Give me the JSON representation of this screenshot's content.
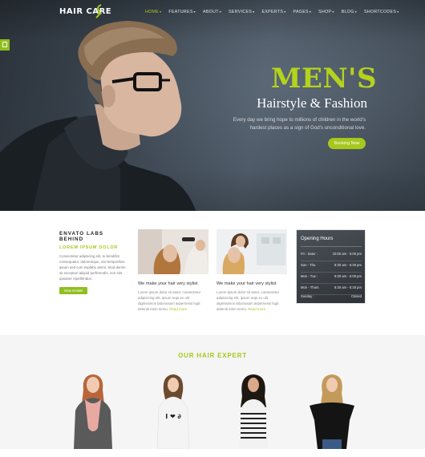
{
  "brand": {
    "name": "HAIR CARE",
    "accent": "#a6c81d"
  },
  "nav": {
    "items": [
      {
        "label": "HOME",
        "active": true
      },
      {
        "label": "FEATURES",
        "active": false
      },
      {
        "label": "ABOUT",
        "active": false
      },
      {
        "label": "SERVICES",
        "active": false
      },
      {
        "label": "EXPERTS",
        "active": false
      },
      {
        "label": "PAGES",
        "active": false
      },
      {
        "label": "SHOP",
        "active": false
      },
      {
        "label": "BLOG",
        "active": false
      },
      {
        "label": "SHORTCODES",
        "active": false
      }
    ]
  },
  "hero": {
    "title": "MEN'S",
    "subtitle": "Hairstyle & Fashion",
    "text": "Every day we bring hope to millions of children in the world's hardest places as a sign of God's unconditional love.",
    "button": "Booking Now"
  },
  "intro": {
    "heading": "ENVATO LABS BEHIND",
    "subheading": "LOREM IPSUM DOLOR",
    "body": "Consectetur adipiscing elit, to bendifim consequatur, doloremque, nisi temporibus ipsum sed cum explabo animi. Stud denim sit excepturi aliquid perferendis, non sint qusaner repellendus.",
    "button": "View Details"
  },
  "cards": [
    {
      "title": "We make your hair very stylist",
      "body": "Lorem ipsum dolor sit amet, consectetur adipisicing elit, ipsum reqs ex ulit dignissimos laboriosam aspernessi fugit deleniti enim nemo.",
      "more": "Read more"
    },
    {
      "title": "We make your hair very stylist",
      "body": "Lorem ipsum dolor sit amet, consectetur adipisicing elit, ipsum reqs ex ulit dignissimos laboriosam aspernessi fugit deleniti enim nemo.",
      "more": "Read more"
    }
  ],
  "hours": {
    "heading": "Opening Hours",
    "rows": [
      {
        "day": "Fri - Satur :",
        "time": "10:00 am - 6:00 pm"
      },
      {
        "day": "Sun - Thu",
        "time": "8:30 am - 5:30 pm"
      },
      {
        "day": "Mon - Tue :",
        "time": "9:30 am - 5:00 pm"
      },
      {
        "day": "Mon - Thurs",
        "time": "8:30 am - 5:30 pm"
      },
      {
        "day": "Sunday :",
        "time": "Closed"
      }
    ]
  },
  "experts": {
    "heading": "OUR HAIR EXPERT",
    "shirt_text": "I ❤ ∂"
  }
}
